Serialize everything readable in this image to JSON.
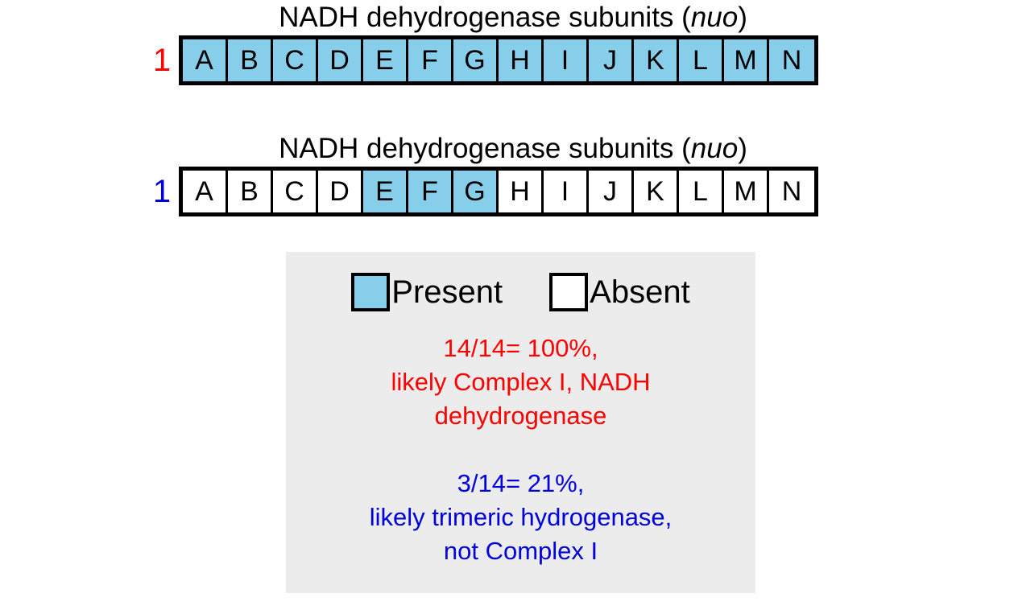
{
  "clusters": [
    {
      "title_prefix": "NADH dehydrogenase subunits (",
      "title_gene": "nuo",
      "title_suffix": ")",
      "index_label": "1",
      "index_color": "#ff0000",
      "cells": [
        {
          "label": "A",
          "state": "present"
        },
        {
          "label": "B",
          "state": "present"
        },
        {
          "label": "C",
          "state": "present"
        },
        {
          "label": "D",
          "state": "present"
        },
        {
          "label": "E",
          "state": "present"
        },
        {
          "label": "F",
          "state": "present"
        },
        {
          "label": "G",
          "state": "present"
        },
        {
          "label": "H",
          "state": "present"
        },
        {
          "label": "I",
          "state": "present"
        },
        {
          "label": "J",
          "state": "present"
        },
        {
          "label": "K",
          "state": "present"
        },
        {
          "label": "L",
          "state": "present"
        },
        {
          "label": "M",
          "state": "present"
        },
        {
          "label": "N",
          "state": "present"
        }
      ]
    },
    {
      "title_prefix": "NADH dehydrogenase subunits (",
      "title_gene": "nuo",
      "title_suffix": ")",
      "index_label": "1",
      "index_color": "#0000dd",
      "cells": [
        {
          "label": "A",
          "state": "absent"
        },
        {
          "label": "B",
          "state": "absent"
        },
        {
          "label": "C",
          "state": "absent"
        },
        {
          "label": "D",
          "state": "absent"
        },
        {
          "label": "E",
          "state": "present"
        },
        {
          "label": "F",
          "state": "present"
        },
        {
          "label": "G",
          "state": "present"
        },
        {
          "label": "H",
          "state": "absent"
        },
        {
          "label": "I",
          "state": "absent"
        },
        {
          "label": "J",
          "state": "absent"
        },
        {
          "label": "K",
          "state": "absent"
        },
        {
          "label": "L",
          "state": "absent"
        },
        {
          "label": "M",
          "state": "absent"
        },
        {
          "label": "N",
          "state": "absent"
        }
      ]
    }
  ],
  "legend": {
    "present_label": "Present",
    "absent_label": "Absent",
    "present_color": "#87CEEB",
    "absent_color": "#ffffff",
    "panel_color": "#ececec"
  },
  "notes": {
    "red": "14/14= 100%,\nlikely Complex I, NADH\ndehydrogenase",
    "red_color": "#ff0000",
    "blue": "3/14= 21%,\nlikely trimeric hydrogenase,\nnot Complex I",
    "blue_color": "#0000dd"
  }
}
